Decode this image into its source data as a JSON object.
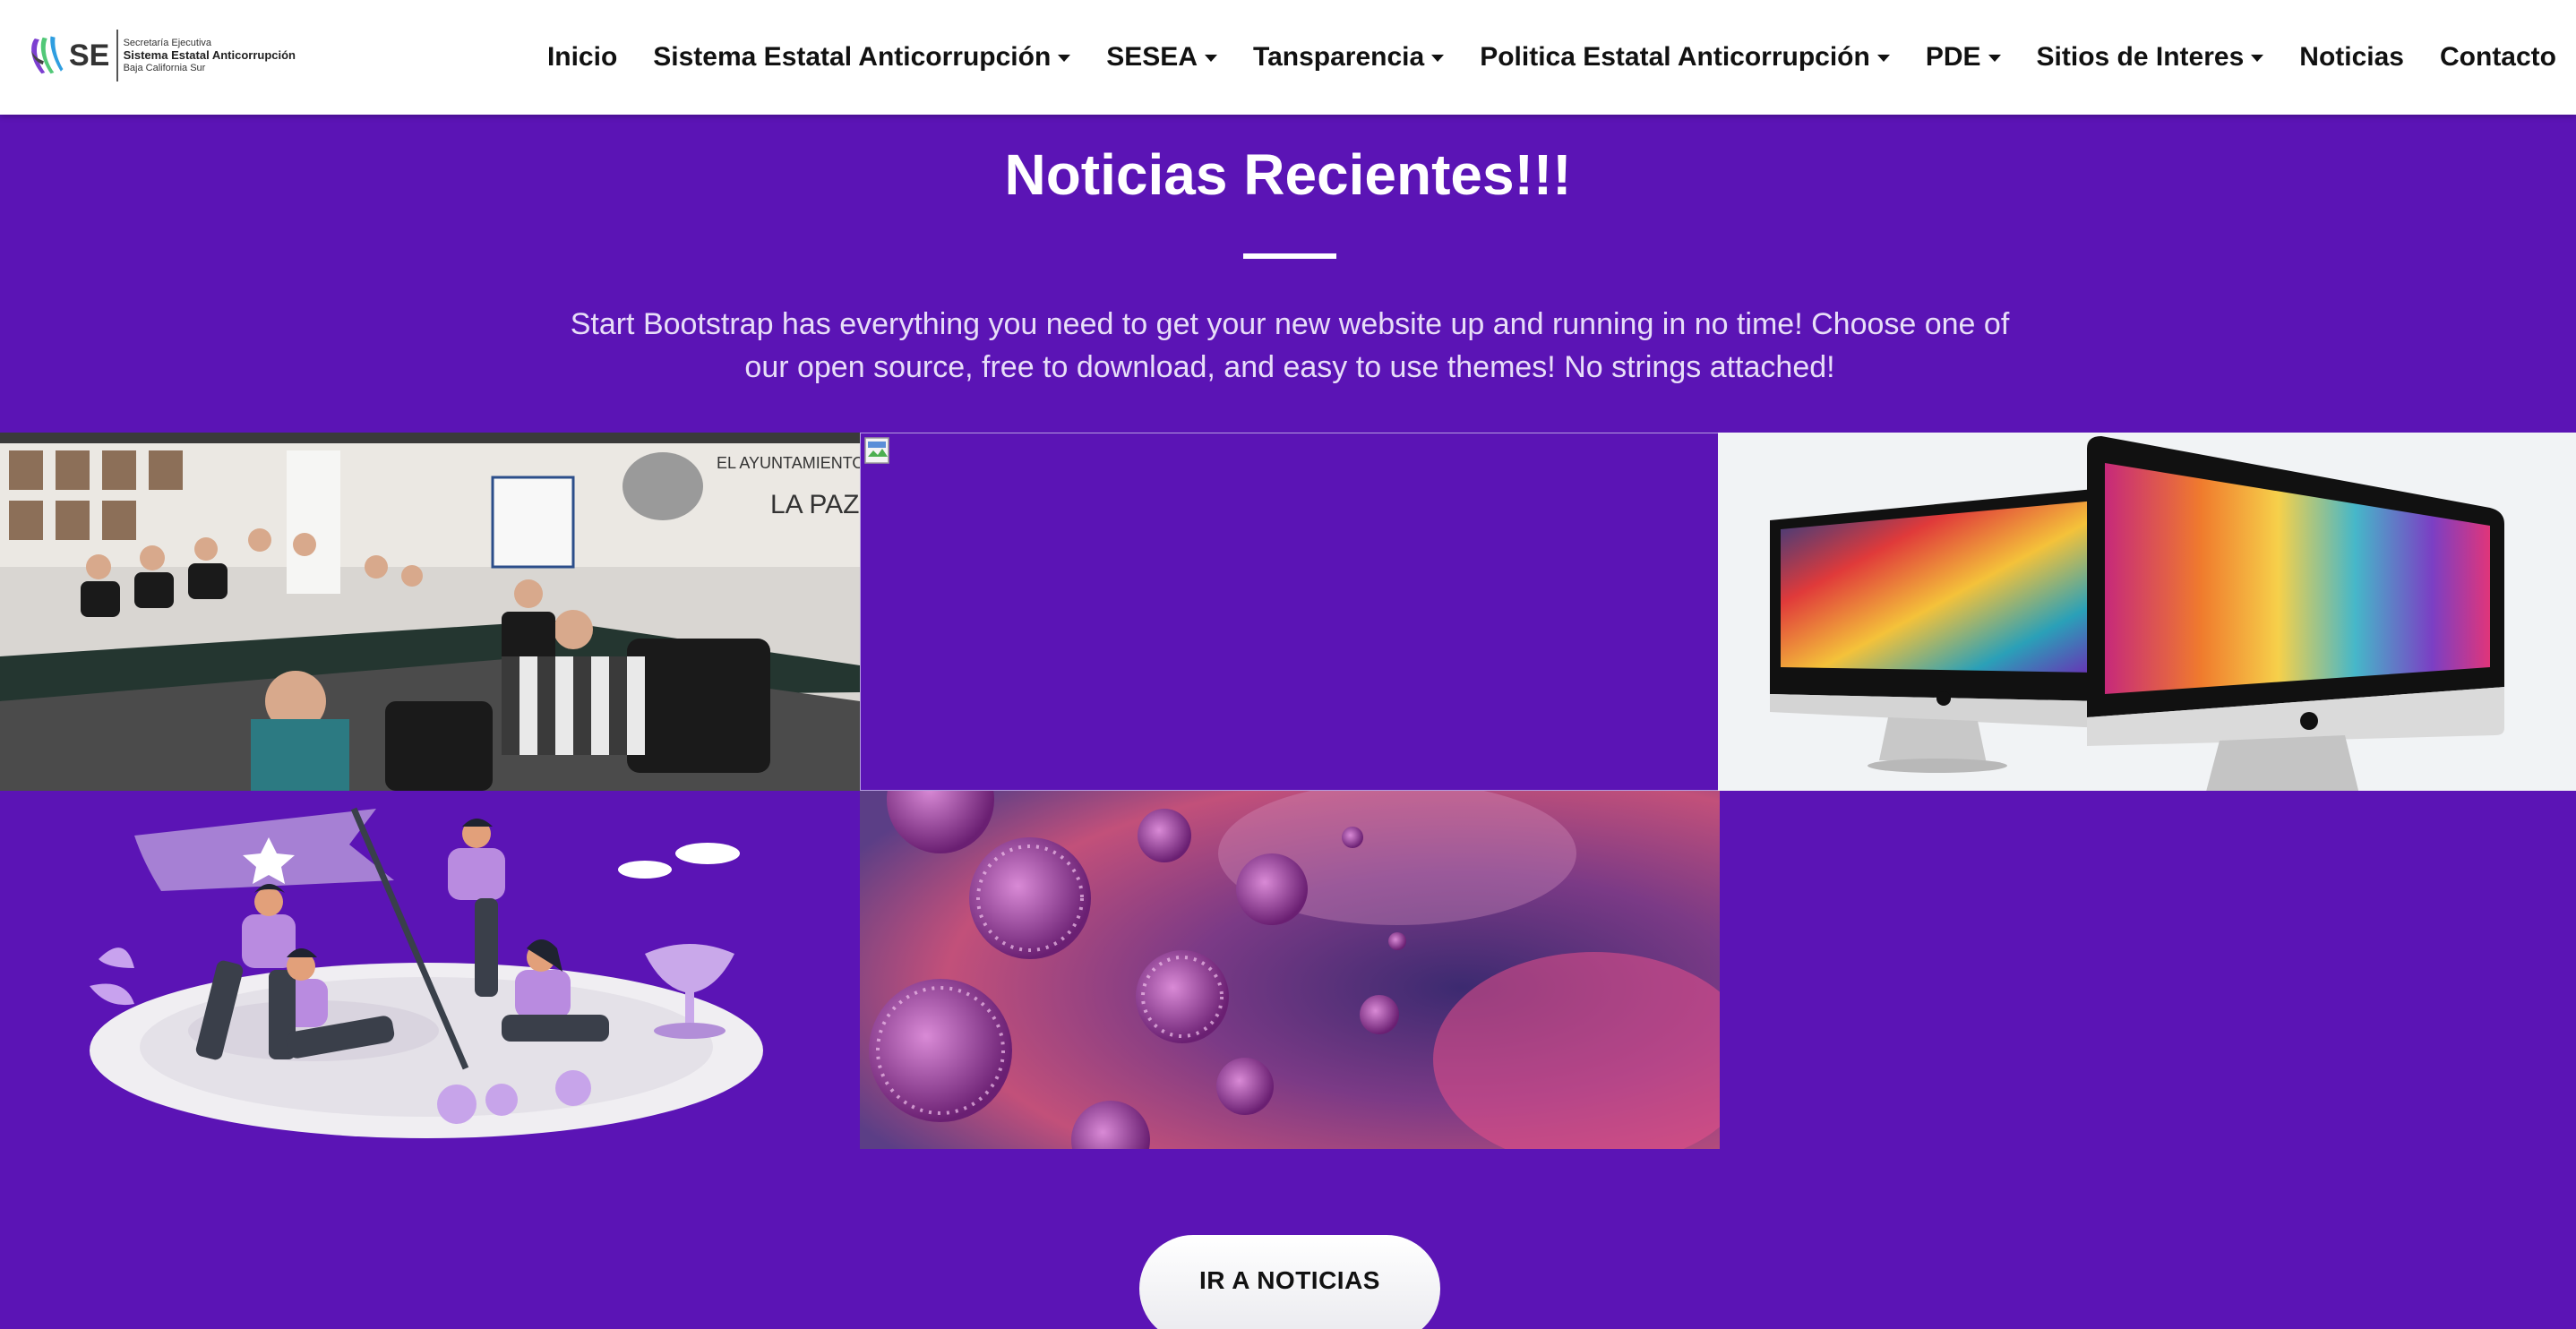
{
  "brand": {
    "acronym": "SE",
    "line1": "Secretaría Ejecutiva",
    "line2": "Sistema Estatal Anticorrupción",
    "line3": "Baja California Sur",
    "logo_icon": "sea-bcs-logo-icon"
  },
  "nav": {
    "items": [
      {
        "label": "Inicio",
        "dropdown": false
      },
      {
        "label": "Sistema Estatal Anticorrupción",
        "dropdown": true
      },
      {
        "label": "SESEA",
        "dropdown": true
      },
      {
        "label": "Tansparencia",
        "dropdown": true
      },
      {
        "label": "Politica Estatal Anticorrupción",
        "dropdown": true
      },
      {
        "label": "PDE",
        "dropdown": true
      },
      {
        "label": "Sitios de Interes",
        "dropdown": true
      },
      {
        "label": "Noticias",
        "dropdown": false
      },
      {
        "label": "Contacto",
        "dropdown": false
      }
    ]
  },
  "hero": {
    "title": "Noticias Recientes!!!",
    "text": "Start Bootstrap has everything you need to get your new website up and running in no time! Choose one of our open source, free to download, and easy to use themes! No strings attached!"
  },
  "gallery": {
    "tiles": [
      {
        "image": "meeting-photo"
      },
      {
        "image": "broken-image-icon"
      },
      {
        "image": "imac-computers-photo"
      },
      {
        "image": "team-flag-illustration"
      },
      {
        "image": "virus-particles-image"
      }
    ]
  },
  "cta": {
    "label": "IR A NOTICIAS"
  },
  "colors": {
    "background": "#5b14b5",
    "navbar": "#ffffff",
    "text": "#ffffff"
  }
}
